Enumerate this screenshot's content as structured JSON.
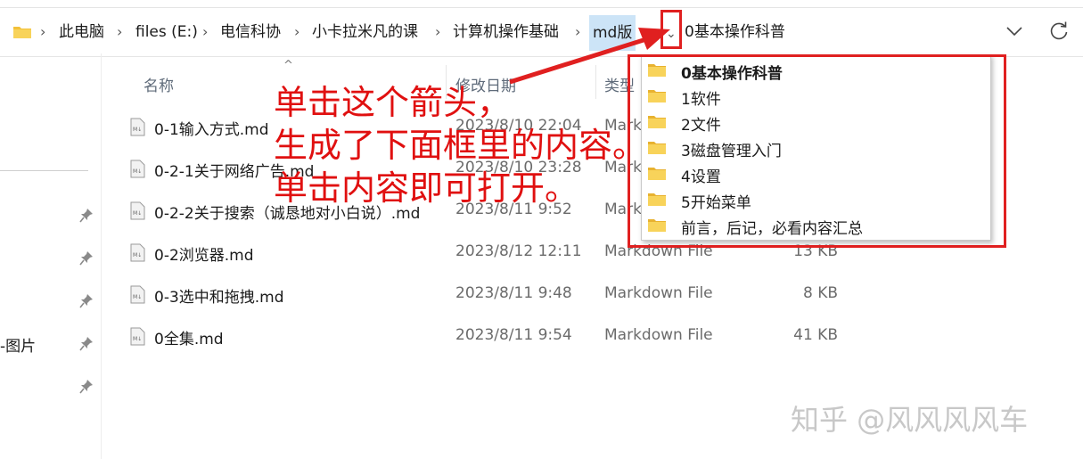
{
  "breadcrumbs": [
    "此电脑",
    "files (E:)",
    "电信科协",
    "小卡拉米凡的课",
    "计算机操作基础",
    "md版"
  ],
  "address_current": "0基本操作科普",
  "left_nav": {
    "label": "-图片"
  },
  "columns": {
    "name": "名称",
    "date": "修改日期",
    "type": "类型"
  },
  "files": [
    {
      "name": "0-1输入方式.md",
      "date": "2023/8/10 22:04",
      "type": "Mark",
      "size": ""
    },
    {
      "name": "0-2-1关于网络广告.md",
      "date": "2023/8/10 23:28",
      "type": "Mark",
      "size": ""
    },
    {
      "name": "0-2-2关于搜索（诚恳地对小白说）.md",
      "date": "2023/8/11 9:52",
      "type": "Mark",
      "size": ""
    },
    {
      "name": "0-2浏览器.md",
      "date": "2023/8/12 12:11",
      "type": "Markdown File",
      "size": "13 KB"
    },
    {
      "name": "0-3选中和拖拽.md",
      "date": "2023/8/11 9:48",
      "type": "Markdown File",
      "size": "8 KB"
    },
    {
      "name": "0全集.md",
      "date": "2023/8/11 9:54",
      "type": "Markdown File",
      "size": "41 KB"
    }
  ],
  "dropdown_items": [
    "0基本操作科普",
    "1软件",
    "2文件",
    "3磁盘管理入门",
    "4设置",
    "5开始菜单",
    "前言，后记，必看内容汇总"
  ],
  "annotation_lines": [
    "单击这个箭头，",
    "生成了下面框里的内容。",
    "单击内容即可打开。"
  ],
  "watermark": "知乎 @风风风风车",
  "colors": {
    "annotation_red": "#e02020",
    "folder_yellow": "#f3c13a",
    "selected_crumb": "#cce4f7"
  }
}
